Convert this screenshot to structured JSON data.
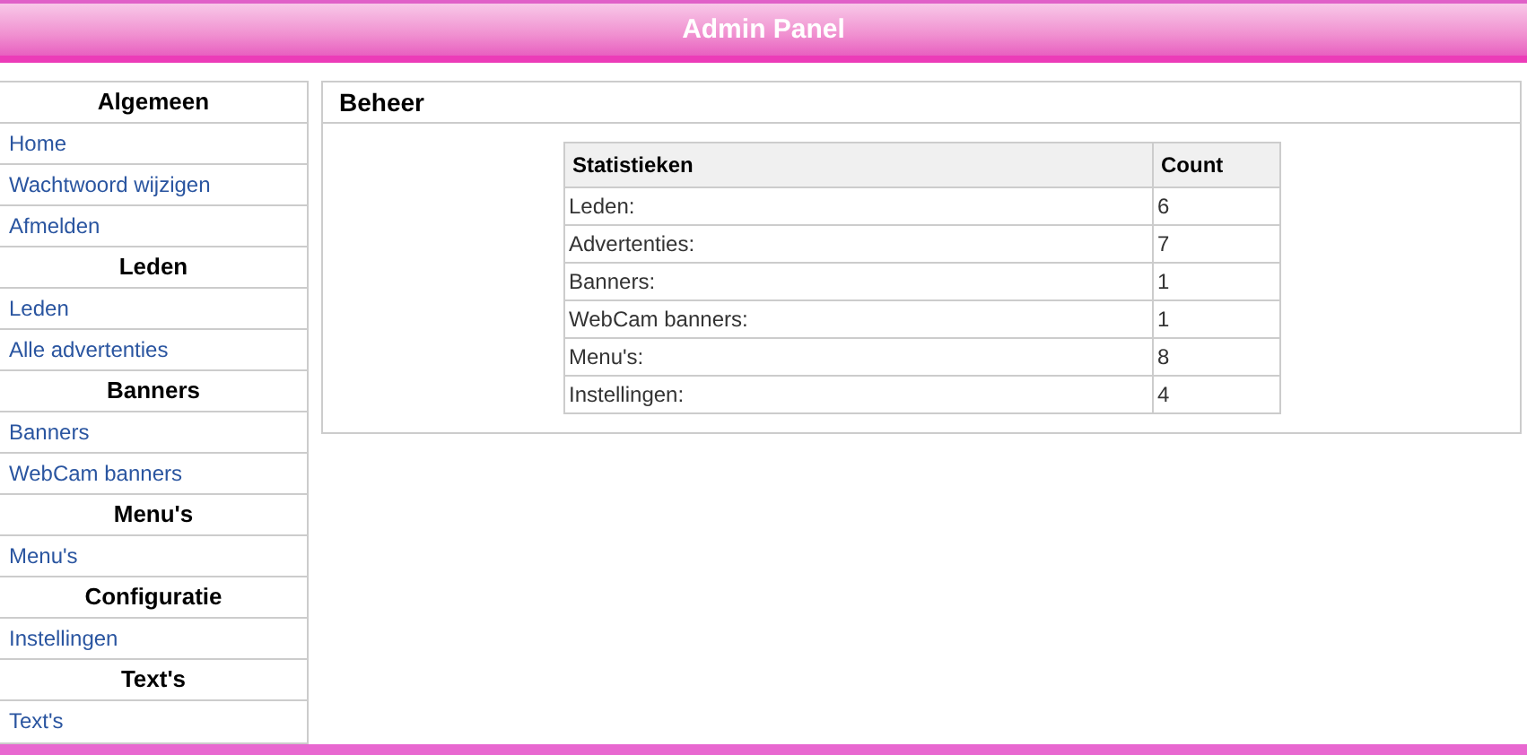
{
  "header": {
    "title": "Admin Panel"
  },
  "sidebar": {
    "sections": [
      {
        "heading": "Algemeen",
        "items": [
          "Home",
          "Wachtwoord wijzigen",
          "Afmelden"
        ]
      },
      {
        "heading": "Leden",
        "items": [
          "Leden",
          "Alle advertenties"
        ]
      },
      {
        "heading": "Banners",
        "items": [
          "Banners",
          "WebCam banners"
        ]
      },
      {
        "heading": "Menu's",
        "items": [
          "Menu's"
        ]
      },
      {
        "heading": "Configuratie",
        "items": [
          "Instellingen"
        ]
      },
      {
        "heading": "Text's",
        "items": [
          "Text's"
        ]
      }
    ]
  },
  "panel": {
    "title": "Beheer",
    "table": {
      "columns": [
        "Statistieken",
        "Count"
      ],
      "rows": [
        [
          "Leden:",
          "6"
        ],
        [
          "Advertenties:",
          "7"
        ],
        [
          "Banners:",
          "1"
        ],
        [
          "WebCam banners:",
          "1"
        ],
        [
          "Menu's:",
          "8"
        ],
        [
          "Instellingen:",
          "4"
        ]
      ]
    }
  }
}
